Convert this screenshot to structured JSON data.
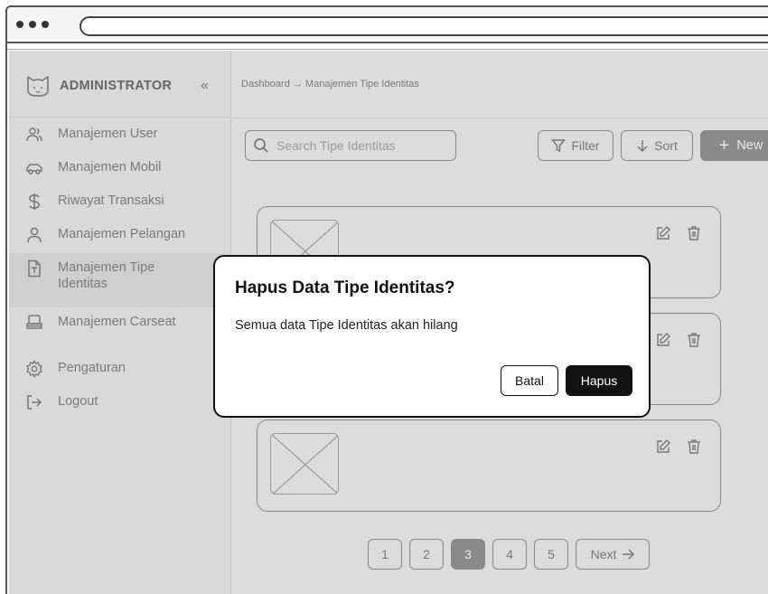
{
  "sidebar": {
    "brand": "ADMINISTRATOR",
    "collapse_icon": "double-chevron-left-icon",
    "items": [
      {
        "label": "Manajemen User",
        "icon": "users-icon"
      },
      {
        "label": "Manajemen Mobil",
        "icon": "car-icon"
      },
      {
        "label": "Riwayat Transaksi",
        "icon": "dollar-icon"
      },
      {
        "label": "Manajemen Pelangan",
        "icon": "user-icon"
      },
      {
        "label": "Manajemen Tipe Identitas",
        "icon": "id-document-icon",
        "active": true
      },
      {
        "label": "Manajemen Carseat",
        "icon": "carseat-icon"
      },
      {
        "label": "Pengaturan",
        "icon": "gear-icon"
      },
      {
        "label": "Logout",
        "icon": "logout-icon"
      }
    ]
  },
  "breadcrumb": "Dashboard → Manajemen Tipe Identitas",
  "toolbar": {
    "search_placeholder": "Search Tipe Identitas",
    "filter_label": "Filter",
    "sort_label": "Sort",
    "new_label": "New"
  },
  "pagination": {
    "pages": [
      "1",
      "2",
      "3",
      "4",
      "5"
    ],
    "current": "3",
    "next_label": "Next"
  },
  "modal": {
    "title": "Hapus Data Tipe Identitas?",
    "body": "Semua data Tipe Identitas akan hilang",
    "cancel_label": "Batal",
    "confirm_label": "Hapus"
  },
  "colors": {
    "modal_primary": "#111111",
    "overlay_gray": "#dcdcdc",
    "active_button": "#8a8a8a"
  }
}
